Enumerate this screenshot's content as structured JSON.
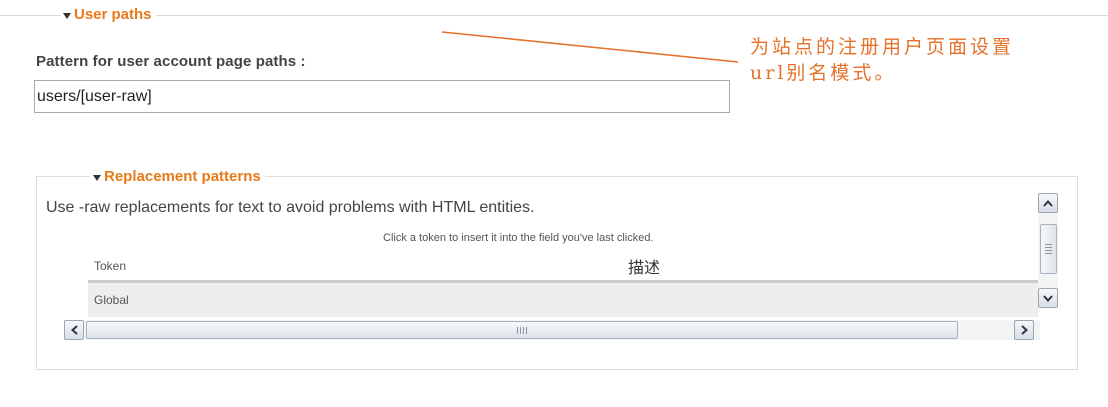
{
  "user_paths": {
    "legend": "User paths",
    "field_label": "Pattern for user account page paths :",
    "field_value": "users/[user-raw]"
  },
  "annotation": {
    "line1": "为站点的注册用户页面设置",
    "line2": "url别名模式。",
    "color": "#e5722a"
  },
  "replacement": {
    "legend": "Replacement patterns",
    "description": "Use -raw replacements for text to avoid problems with HTML entities.",
    "help": "Click a token to insert it into the field you've last clicked.",
    "columns": [
      "Token",
      "描述"
    ],
    "rows": [
      {
        "token": "Global",
        "description": ""
      }
    ]
  },
  "scrollbars": {
    "up_icon": "arrow-up-icon",
    "down_icon": "arrow-down-icon",
    "left_icon": "arrow-left-icon",
    "right_icon": "arrow-right-icon",
    "grip_icon": "grip-icon"
  },
  "colors": {
    "legend": "#e87a1c",
    "border": "#dddddd",
    "row_bg": "#eeeeee"
  }
}
